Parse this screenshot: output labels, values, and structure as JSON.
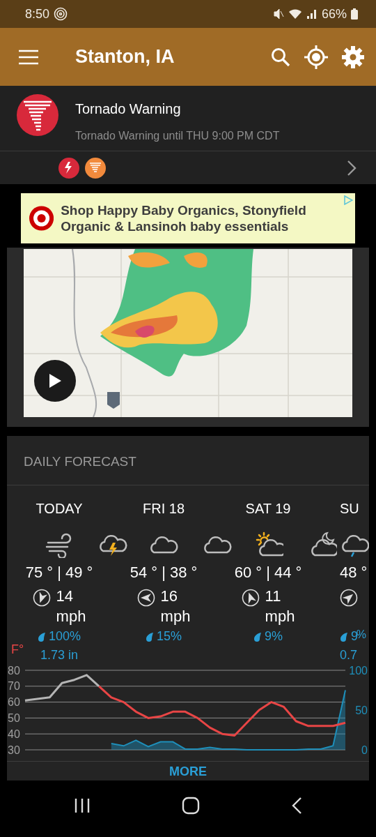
{
  "status_bar": {
    "time": "8:50",
    "battery": "66%"
  },
  "app_bar": {
    "title": "Stanton, IA"
  },
  "alert": {
    "title": "Tornado Warning",
    "subtitle": "Tornado Warning until THU 9:00 PM CDT",
    "badges": [
      {
        "kind": "lightning",
        "color": "#d8293b"
      },
      {
        "kind": "tornado",
        "color": "#f28a3c"
      }
    ]
  },
  "ad": {
    "text": "Shop Happy Baby Organics, Stonyfield Organic & Lansinoh baby essentials"
  },
  "forecast": {
    "title": "DAILY FORECAST",
    "days": [
      {
        "kind": "full",
        "day": "TODAY",
        "icons": [
          {
            "kind": "wind"
          },
          {
            "kind": "storm"
          }
        ],
        "temps": "75 ° | 49 °",
        "wind": "14",
        "wind_unit": "mph",
        "precip": "100%",
        "rain": "1.73 in"
      },
      {
        "kind": "full",
        "day": "FRI 18",
        "icons": [
          {
            "kind": "cloud"
          },
          {
            "kind": "cloud"
          }
        ],
        "temps": "54 ° | 38 °",
        "wind": "16",
        "wind_unit": "mph",
        "precip": "15%"
      },
      {
        "kind": "full",
        "day": "SAT 19",
        "icons": [
          {
            "kind": "sun-cloud"
          },
          {
            "kind": "moon-cloud"
          }
        ],
        "temps": "60 ° | 44 °",
        "wind": "11",
        "wind_unit": "mph",
        "precip": "9%"
      },
      {
        "kind": "partial",
        "day": "SU",
        "icons": [
          {
            "kind": "rain"
          }
        ],
        "temps": "48 °",
        "precip": "9",
        "rain": "0.7"
      }
    ],
    "chart_left_unit": "F°",
    "chart_right_unit": "%",
    "chart_data": {
      "type": "line",
      "ylim": [
        30,
        80
      ],
      "yticks": [
        30,
        40,
        50,
        60,
        70,
        80
      ],
      "grid": true,
      "y2lim": [
        0,
        100
      ],
      "y2ticks": [
        0,
        50,
        100
      ],
      "series": [
        {
          "color": "#b5b5b5",
          "values": [
            61,
            62,
            63,
            72,
            74,
            77,
            70,
            null,
            null,
            null,
            null,
            null,
            null,
            null,
            null,
            null,
            null,
            null,
            null,
            null,
            null,
            null,
            null,
            null,
            null,
            null,
            null
          ]
        },
        {
          "color": "#e84545",
          "values": [
            null,
            null,
            null,
            null,
            null,
            null,
            70,
            63,
            60,
            54,
            50,
            51,
            54,
            54,
            50,
            44,
            40,
            39,
            47,
            55,
            60,
            57,
            48,
            45,
            45,
            45,
            47
          ]
        },
        {
          "color": "#1e8fba",
          "axis": "y2",
          "values": [
            null,
            null,
            null,
            null,
            null,
            null,
            null,
            8,
            5,
            12,
            4,
            10,
            10,
            1,
            1,
            3,
            1,
            1,
            0,
            0,
            0,
            0,
            0,
            1,
            1,
            5,
            75
          ]
        }
      ]
    },
    "more": "MORE"
  }
}
